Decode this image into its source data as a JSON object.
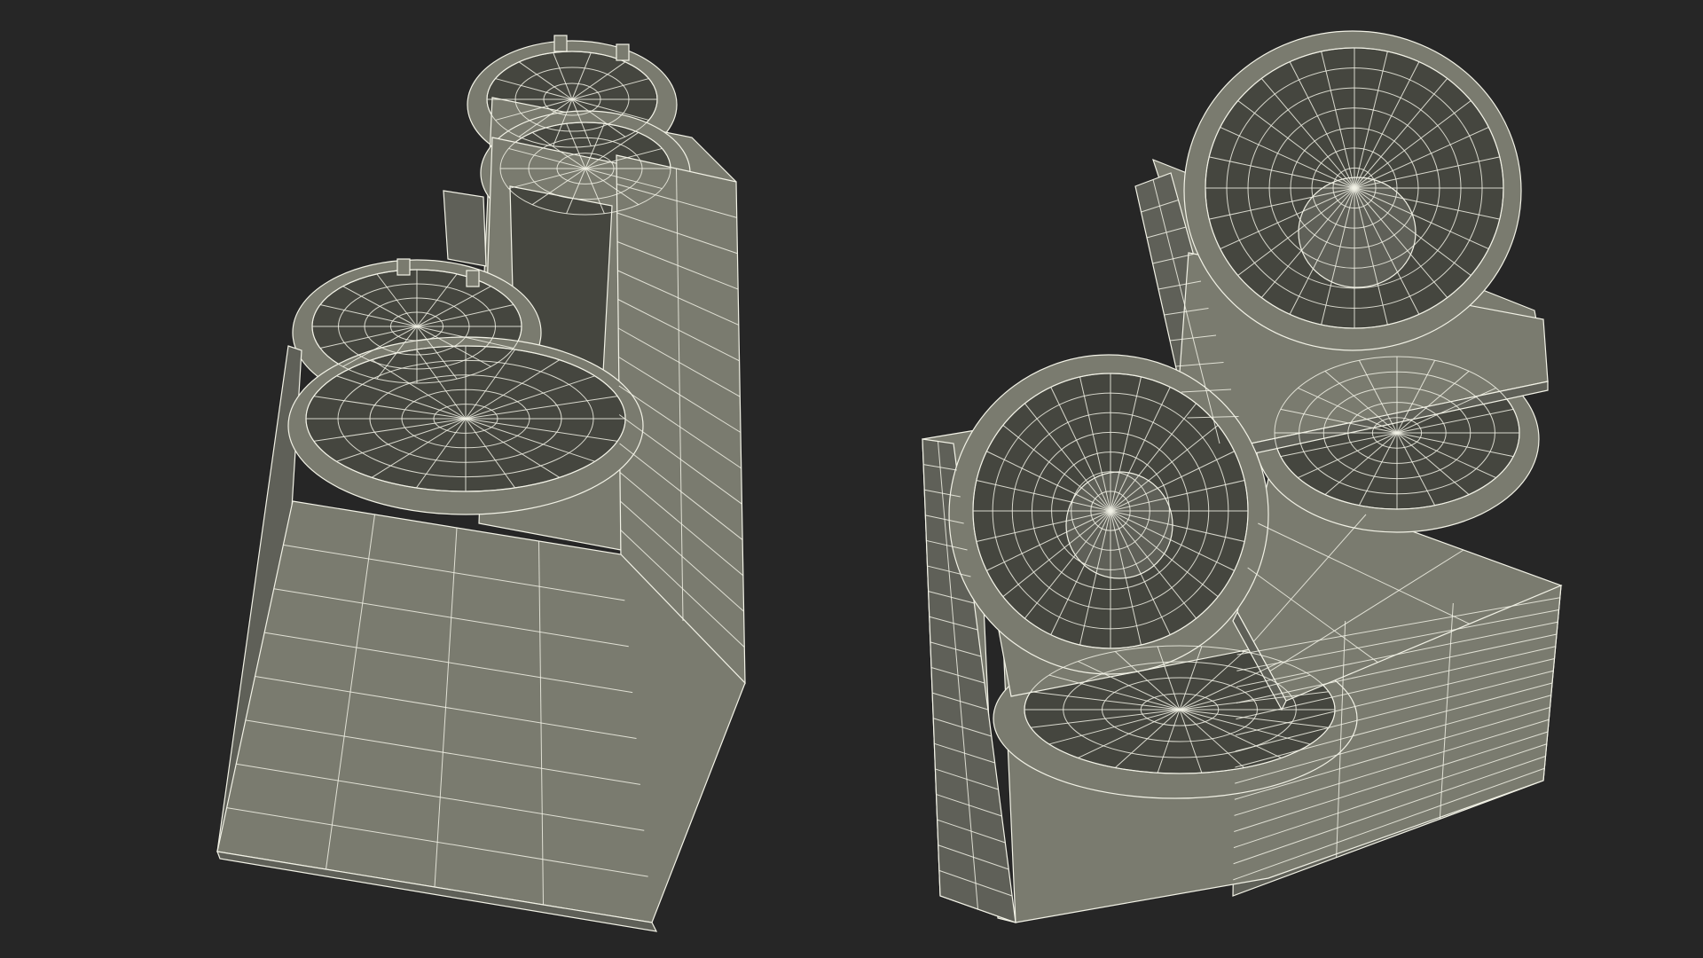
{
  "scene": {
    "background_color": "#262626",
    "surface_color": "#7a7b6f",
    "surface_shade_color": "#5f6058",
    "surface_dark_color": "#45463f",
    "wire_color": "#f2f2e6"
  },
  "models": [
    {
      "id": "left",
      "subject": "wireframe-model-desk-organizer-side-view"
    },
    {
      "id": "right",
      "subject": "wireframe-model-desk-organizer-top-view"
    }
  ]
}
